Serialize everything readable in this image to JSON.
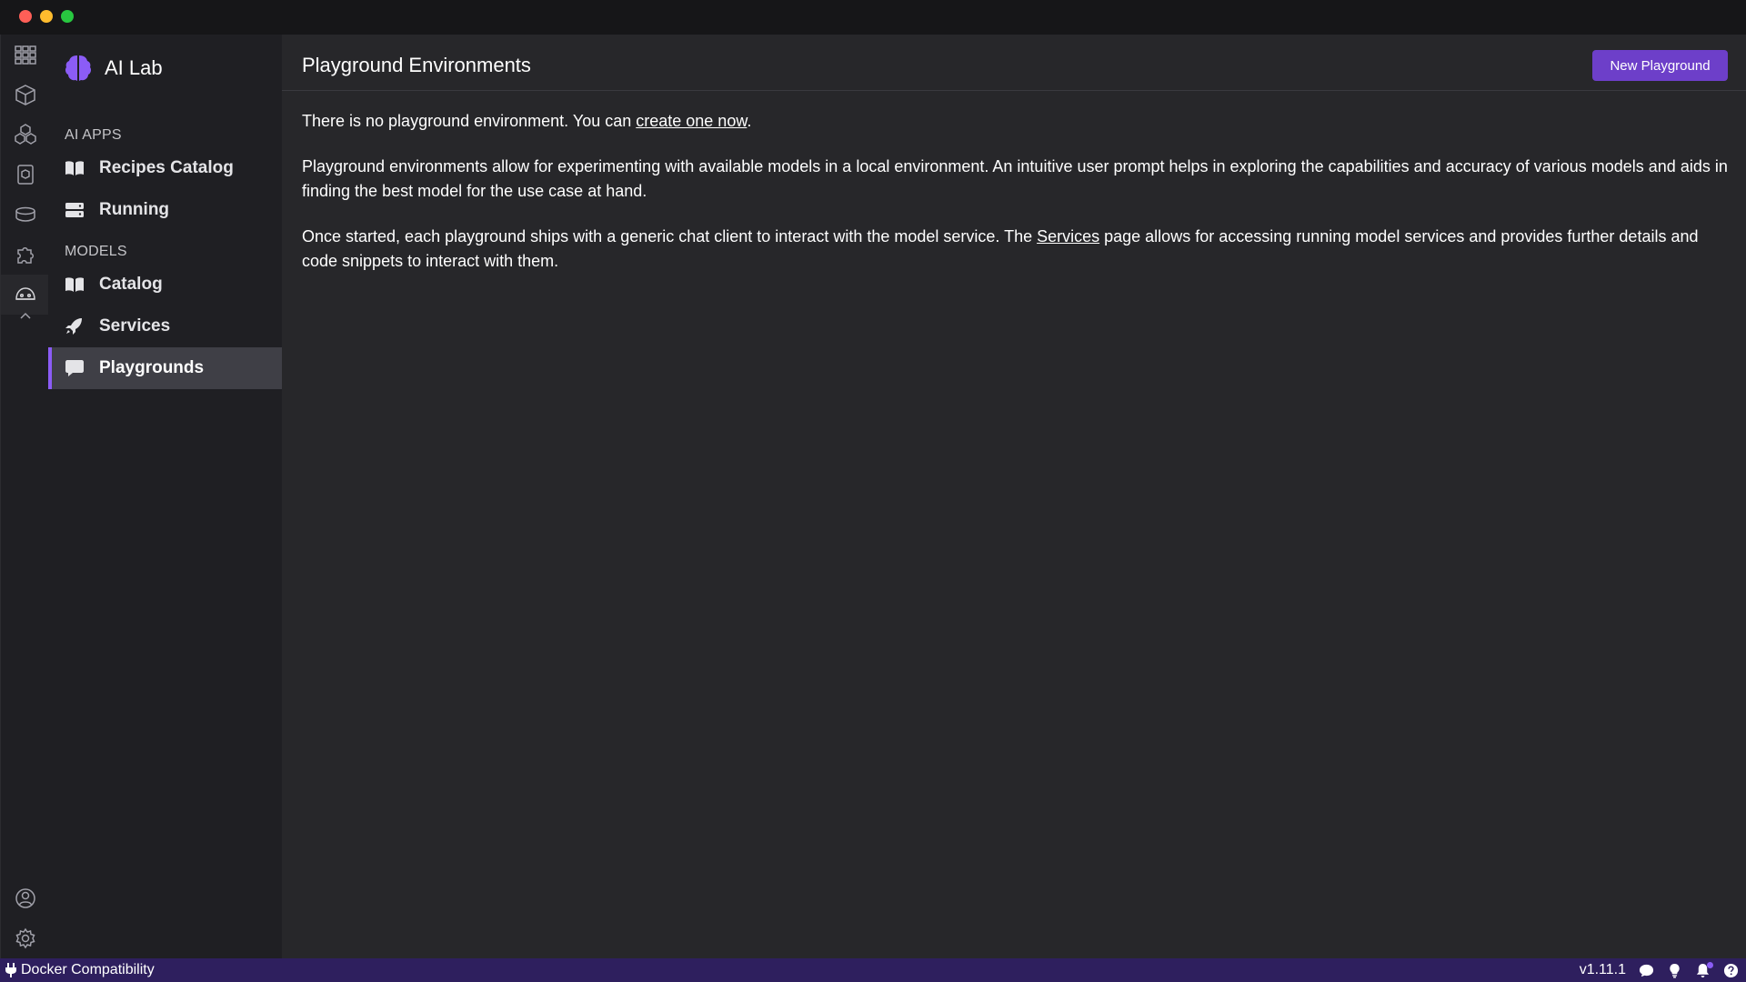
{
  "window": {
    "controls": [
      "close",
      "minimize",
      "maximize"
    ]
  },
  "rail": {
    "icons": [
      "dashboard-icon",
      "containers-icon",
      "pods-icon",
      "images-icon",
      "volumes-icon",
      "extensions-icon",
      "ai-lab-icon",
      "collapse-chevron-icon",
      "account-icon",
      "settings-icon"
    ]
  },
  "sidebar": {
    "app_title": "AI Lab",
    "sections": [
      {
        "label": "AI APPS",
        "items": [
          {
            "label": "Recipes Catalog",
            "icon": "book-icon"
          },
          {
            "label": "Running",
            "icon": "server-icon"
          }
        ]
      },
      {
        "label": "MODELS",
        "items": [
          {
            "label": "Catalog",
            "icon": "book-icon"
          },
          {
            "label": "Services",
            "icon": "rocket-icon"
          },
          {
            "label": "Playgrounds",
            "icon": "chat-icon",
            "active": true
          }
        ]
      }
    ]
  },
  "main": {
    "title": "Playground Environments",
    "new_button": "New Playground",
    "para1_prefix": "There is no playground environment. You can ",
    "para1_link": "create one now",
    "para1_suffix": ".",
    "para2": "Playground environments allow for experimenting with available models in a local environment. An intuitive user prompt helps in exploring the capabilities and accuracy of various models and aids in finding the best model for the use case at hand.",
    "para3_prefix": "Once started, each playground ships with a generic chat client to interact with the model service. The ",
    "para3_link": "Services",
    "para3_suffix": " page allows for accessing running model services and provides further details and code snippets to interact with them."
  },
  "statusbar": {
    "left_label": "Docker Compatibility",
    "version": "v1.11.1"
  },
  "colors": {
    "accent": "#6d3fc9",
    "active_indicator": "#8b5cf6",
    "statusbar_bg": "#2e1f5e"
  }
}
